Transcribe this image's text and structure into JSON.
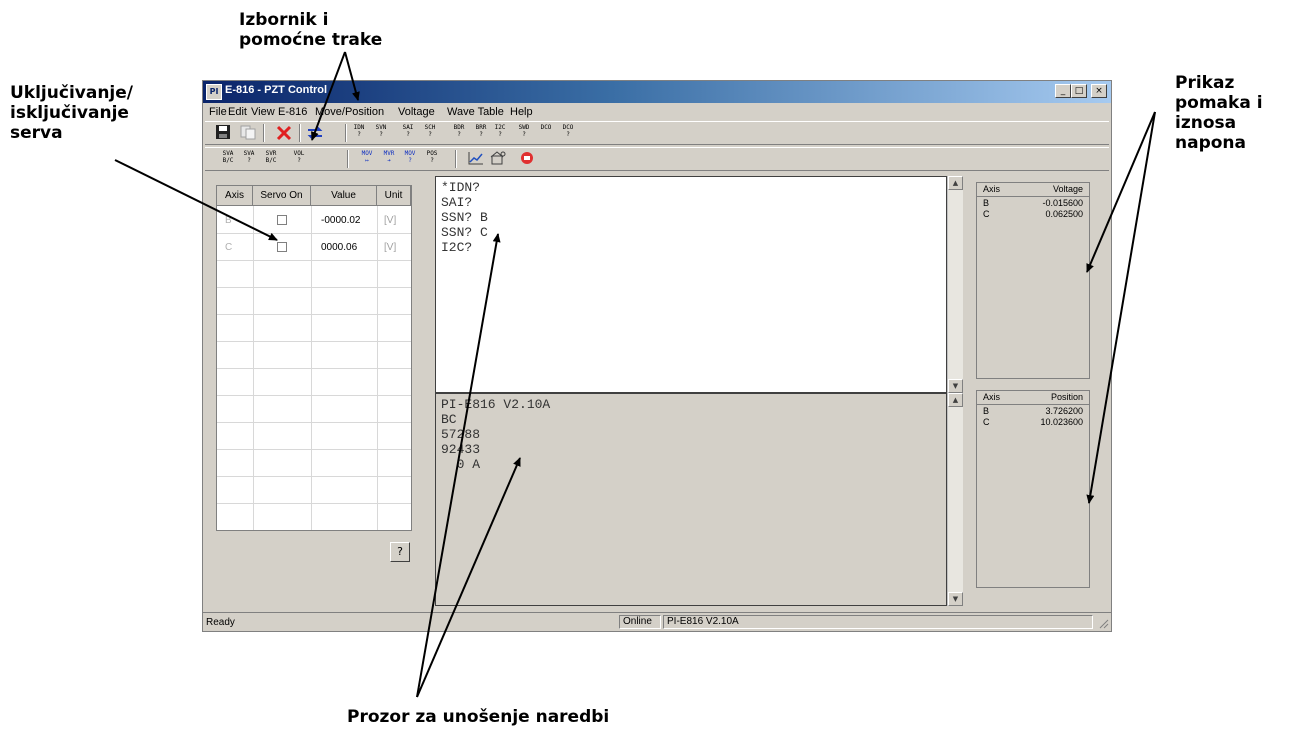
{
  "annotations": {
    "menu_toolbars": "Izbornik i\npomoćne trake",
    "servo_toggle": "Uključivanje/\nisključivanje\nserva",
    "display": "Prikaz\npomaka i\niznosa\nnapona",
    "command_window": "Prozor za unošenje naredbi"
  },
  "window": {
    "title": "E-816 - PZT Control",
    "app_icon_label": "PI",
    "minimize": "_",
    "maximize": "□",
    "close": "×"
  },
  "menu": [
    "File",
    "Edit",
    "View",
    "E-816",
    "Move/Position",
    "Voltage",
    "Wave Table",
    "Help"
  ],
  "toolbar1": {
    "save": "save-icon",
    "copy": "copy-icon",
    "delete": "delete-icon",
    "connect": "connect-icon",
    "buttons": [
      "IDN\n?",
      "SVN\n?",
      "SAI\n?",
      "SCH\n?",
      "BDR\n?",
      "BRR\n?",
      "I2C\n?",
      "SWD\n?",
      "DCO",
      "DCO\n?"
    ]
  },
  "toolbar2": {
    "buttons": [
      "SVA\nB/C",
      "SVA\n?",
      "SVR\nB/C",
      "VOL\n?",
      "MOV\n↦",
      "MVR\n➔",
      "MOV\n?",
      "POS\n?"
    ],
    "graph": "graph-icon",
    "settings": "settings-icon",
    "stop": "stop-icon"
  },
  "axes_grid": {
    "headers": [
      "Axis",
      "Servo On",
      "Value",
      "Unit"
    ],
    "rows": [
      {
        "axis": "B",
        "servo_on": false,
        "value": "-0000.02",
        "unit": "[V]"
      },
      {
        "axis": "C",
        "servo_on": false,
        "value": "0000.06",
        "unit": "[V]"
      }
    ],
    "help_button": "?"
  },
  "command_input": {
    "lines": [
      "*IDN?",
      "SAI?",
      "SSN? B",
      "SSN? C",
      "I2C?"
    ]
  },
  "command_output": {
    "lines": [
      "PI-E816 V2.10A",
      "BC",
      "57288",
      "92433",
      "  0 A"
    ]
  },
  "voltage_panel": {
    "headers": [
      "Axis",
      "Voltage"
    ],
    "rows": [
      {
        "axis": "B",
        "value": "-0.015600"
      },
      {
        "axis": "C",
        "value": "0.062500"
      }
    ]
  },
  "position_panel": {
    "headers": [
      "Axis",
      "Position"
    ],
    "rows": [
      {
        "axis": "B",
        "value": "3.726200"
      },
      {
        "axis": "C",
        "value": "10.023600"
      }
    ]
  },
  "status_bar": {
    "left": "Ready",
    "connection": "Online",
    "version": "PI-E816 V2.10A"
  }
}
